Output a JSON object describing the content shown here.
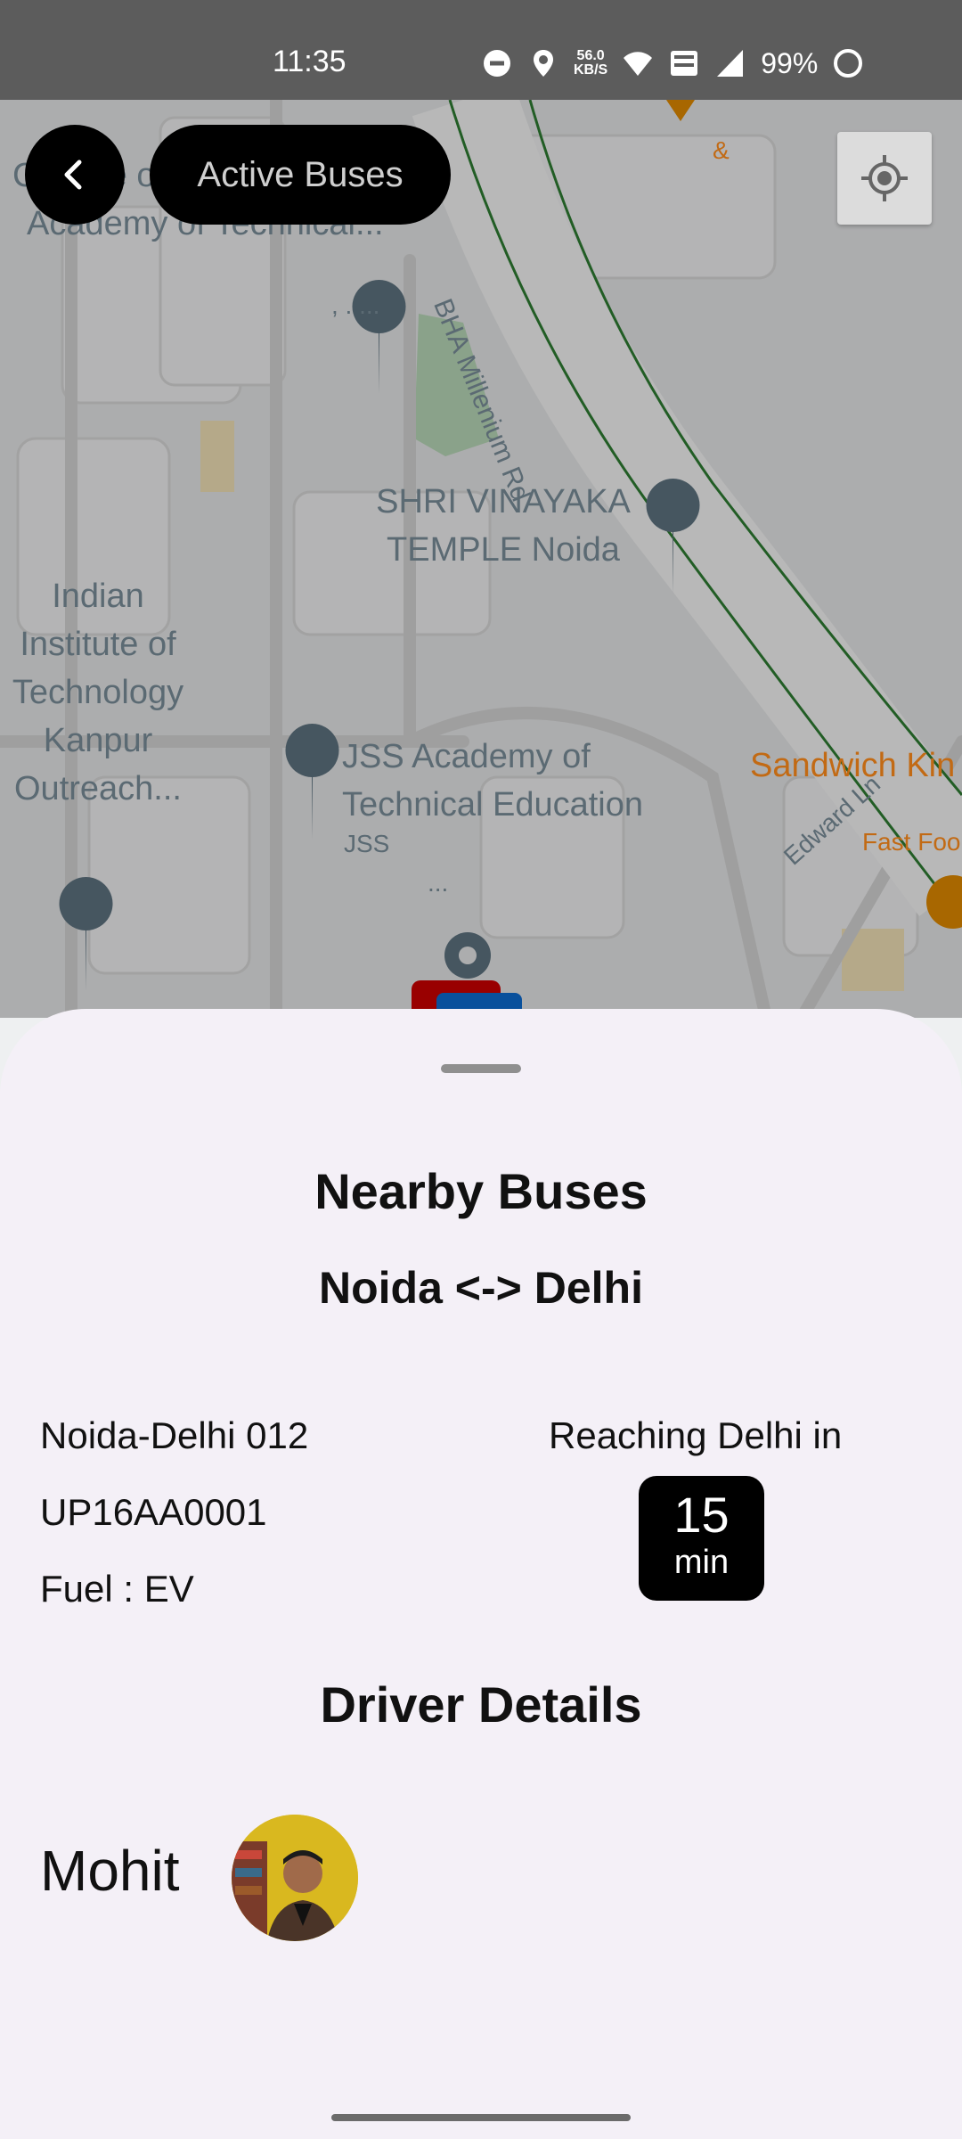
{
  "status_bar": {
    "time": "11:35",
    "net_speed_value": "56.0",
    "net_speed_unit": "KB/S",
    "battery": "99%",
    "icons": [
      "dnd-icon",
      "location-icon",
      "wifi-icon",
      "volte-icon",
      "signal-icon",
      "battery-icon"
    ]
  },
  "map": {
    "labels": {
      "college_top": "College of",
      "academy_top": "Academy of Technical...",
      "dots": ", . ...",
      "road_main": "BHA Millenium Rd",
      "temple": "SHRI VINAYAKA TEMPLE Noida",
      "iit": "Indian Institute of Technology Kanpur Outreach...",
      "jss": "JSS Academy of Technical Education",
      "jss_short": "JSS",
      "jss_more": "...",
      "edward": "Edward Ln",
      "sandwich": "Sandwich Kin",
      "fastfood": "Fast Foo",
      "ampersand": "&"
    },
    "colors": {
      "road_green": "#2e7d32",
      "poi_orange": "#c26a14",
      "pin_gray": "#5e7380"
    }
  },
  "header": {
    "back_icon": "chevron-left-icon",
    "title": "Active Buses",
    "locate_icon": "my-location-icon"
  },
  "sheet": {
    "title": "Nearby Buses",
    "route": "Noida <-> Delhi",
    "bus": {
      "name": "Noida-Delhi 012",
      "registration": "UP16AA0001",
      "fuel": "Fuel : EV"
    },
    "eta": {
      "label": "Reaching Delhi in",
      "value": "15",
      "unit": "min"
    },
    "driver_section_title": "Driver Details",
    "driver": {
      "name": "Mohit"
    }
  }
}
